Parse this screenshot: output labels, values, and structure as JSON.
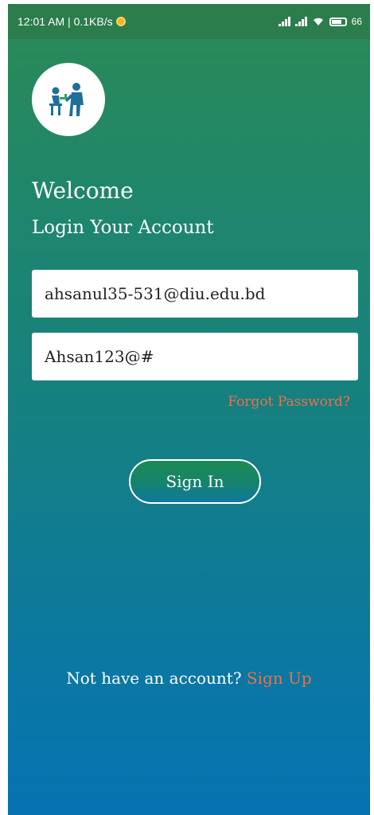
{
  "status_bar": {
    "time_speed": "12:01 AM | 0.1KB/s",
    "battery": "66",
    "notification_color": "#f2b51c"
  },
  "login": {
    "welcome": "Welcome",
    "subtitle": "Login Your Account",
    "email_value": "ahsanul35-531@diu.edu.bd",
    "password_value": "Ahsan123@#",
    "forgot_label": "Forgot Password?",
    "signin_label": "Sign In",
    "no_account_text": "Not have an account?",
    "signup_label": "Sign Up"
  },
  "colors": {
    "accent": "#e6734a",
    "gradient_top": "#2a8a55",
    "gradient_bottom": "#0672b2"
  },
  "icons": {
    "avatar": "teacher-student-icon"
  }
}
